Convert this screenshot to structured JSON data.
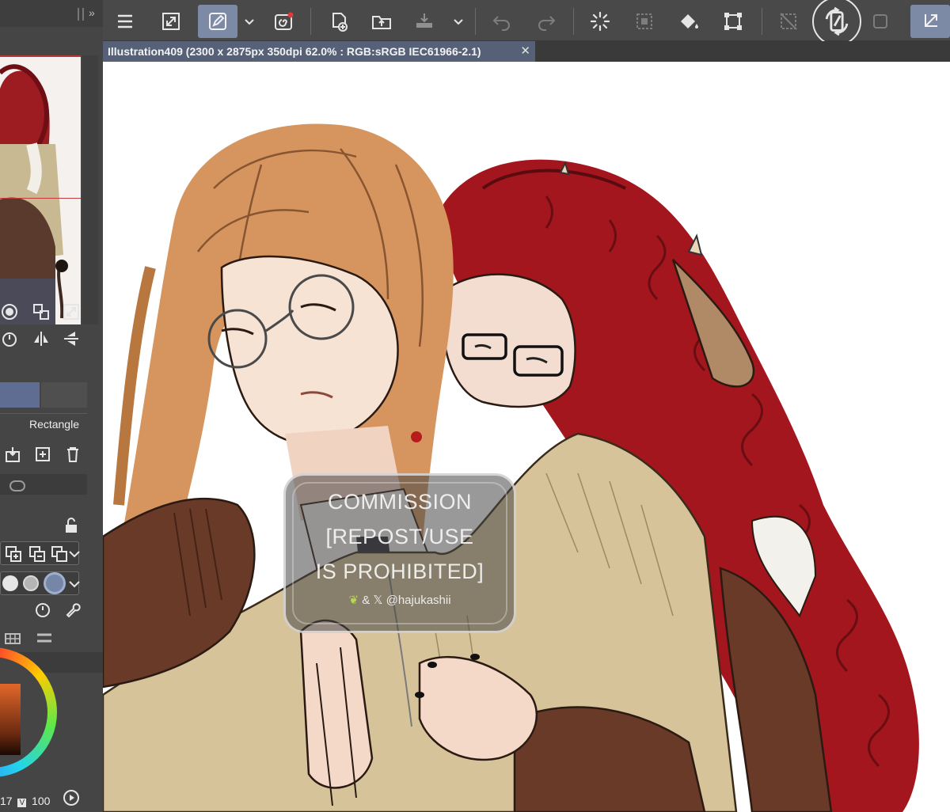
{
  "document": {
    "tab_title": "Illustration409 (2300 x 2875px 350dpi 62.0% : RGB:sRGB IEC61966-2.1)",
    "close_glyph": "✕"
  },
  "toolbar": {
    "buttons": [
      {
        "icon": "menu-icon"
      },
      {
        "icon": "resize-icon"
      },
      {
        "icon": "edit-pen-icon",
        "active": true
      },
      {
        "icon": "chevron-down-icon"
      },
      {
        "icon": "spiral-record-icon"
      },
      {
        "icon": "new-file-icon"
      },
      {
        "icon": "open-folder-icon"
      },
      {
        "icon": "save-icon"
      },
      {
        "icon": "chevron-down-icon"
      },
      {
        "icon": "undo-icon",
        "disabled": true
      },
      {
        "icon": "redo-icon",
        "disabled": true
      },
      {
        "icon": "loading-spinner-icon"
      },
      {
        "icon": "selection-icon",
        "disabled": true
      },
      {
        "icon": "fill-bucket-icon"
      },
      {
        "icon": "transform-icon"
      },
      {
        "icon": "deselect-icon",
        "disabled": true
      },
      {
        "icon": "rotate-canvas-icon"
      },
      {
        "icon": "select-all-icon",
        "disabled": true
      },
      {
        "icon": "corner-arrow-icon",
        "active": true
      }
    ]
  },
  "left_panel": {
    "subtool_label": "Rectangle",
    "bottom_values": {
      "left": "17",
      "v_label": "V",
      "right": "100"
    }
  },
  "watermark": {
    "line1": "COMMISSION",
    "line2": "[REPOST/USE",
    "line3": "IS PROHIBITED]",
    "handle": "& 𝕏 @hajukashii"
  },
  "colors": {
    "active_button": "#7c8aa6",
    "doc_tab": "#566178",
    "panel_bg": "#454545",
    "canvas_bg": "#ffffff"
  }
}
